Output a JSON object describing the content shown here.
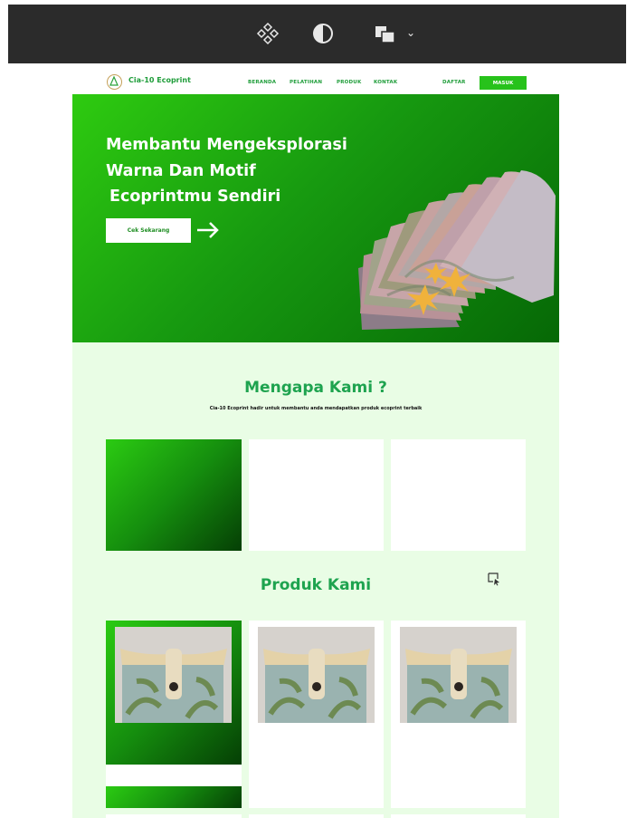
{
  "toolbar": {
    "icons": [
      "components-icon",
      "contrast-icon",
      "layers-icon",
      "chevron-down-icon"
    ]
  },
  "nav": {
    "brand": "Cia-10 Ecoprint",
    "links": [
      "BERANDA",
      "PELATIHAN",
      "PRODUK",
      "KONTAK"
    ],
    "daftar": "DAFTAR",
    "masuk": "MASUK"
  },
  "hero": {
    "line1": "Membantu Mengeksplorasi",
    "line2": "Warna Dan Motif",
    "line3": "Ecoprintmu Sendiri",
    "cta": "Cek Sekarang"
  },
  "why": {
    "title": "Mengapa Kami ?",
    "subtitle": "Cia-10 Ecoprint hadir untuk membantu anda mendapatkan produk ecoprint terbaik"
  },
  "products": {
    "title": "Produk Kami"
  },
  "colors": {
    "brand_green": "#1ea34f",
    "button_green": "#27c21b",
    "background": "#e9fde5",
    "toolbar": "#2b2b2b"
  }
}
